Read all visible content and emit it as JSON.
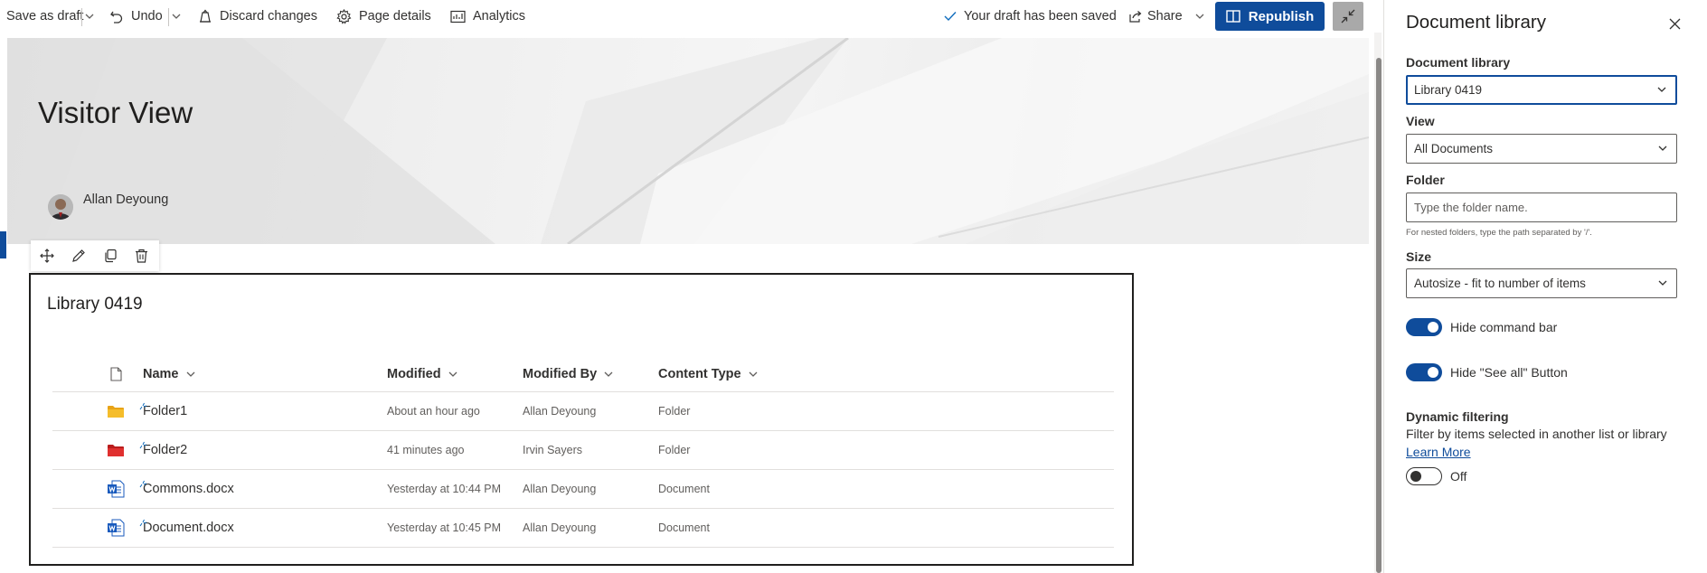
{
  "toolbar": {
    "save_as_draft": "Save as draft",
    "undo": "Undo",
    "discard_changes": "Discard changes",
    "page_details": "Page details",
    "analytics": "Analytics",
    "draft_status": "Your draft has been saved",
    "share": "Share",
    "republish": "Republish"
  },
  "page": {
    "title": "Visitor View",
    "author": "Allan Deyoung"
  },
  "library": {
    "title": "Library 0419",
    "columns": {
      "name": "Name",
      "modified": "Modified",
      "modified_by": "Modified By",
      "content_type": "Content Type"
    },
    "rows": [
      {
        "name": "Folder1",
        "modified": "About an hour ago",
        "modified_by": "Allan Deyoung",
        "content_type": "Folder",
        "icon": "folder-yellow-icon"
      },
      {
        "name": "Folder2",
        "modified": "41 minutes ago",
        "modified_by": "Irvin Sayers",
        "content_type": "Folder",
        "icon": "folder-red-icon"
      },
      {
        "name": "Commons.docx",
        "modified": "Yesterday at 10:44 PM",
        "modified_by": "Allan Deyoung",
        "content_type": "Document",
        "icon": "word-document-icon"
      },
      {
        "name": "Document.docx",
        "modified": "Yesterday at 10:45 PM",
        "modified_by": "Allan Deyoung",
        "content_type": "Document",
        "icon": "word-document-icon"
      }
    ]
  },
  "pane": {
    "title": "Document library",
    "library_label": "Document library",
    "library_value": "Library 0419",
    "view_label": "View",
    "view_value": "All Documents",
    "folder_label": "Folder",
    "folder_placeholder": "Type the folder name.",
    "folder_help": "For nested folders, type the path separated by '/'.",
    "size_label": "Size",
    "size_value": "Autosize - fit to number of items",
    "hide_command_bar": "Hide command bar",
    "hide_see_all": "Hide \"See all\" Button",
    "dynamic_filtering_label": "Dynamic filtering",
    "dynamic_filtering_desc": "Filter by items selected in another list or library",
    "learn_more": "Learn More",
    "toggle_off": "Off"
  },
  "colors": {
    "accent": "#0f4c9b",
    "folder_yellow": "#f5bd2b",
    "folder_red": "#e0302f",
    "word_blue": "#185abd"
  }
}
